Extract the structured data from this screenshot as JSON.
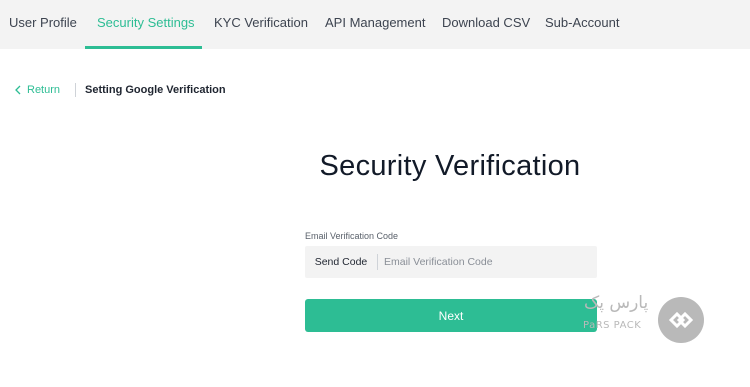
{
  "tabs": [
    {
      "label": "User Profile",
      "active": false
    },
    {
      "label": "Security Settings",
      "active": true
    },
    {
      "label": "KYC Verification",
      "active": false
    },
    {
      "label": "API Management",
      "active": false
    },
    {
      "label": "Download CSV",
      "active": false
    },
    {
      "label": "Sub-Account",
      "active": false
    }
  ],
  "breadcrumb": {
    "back_icon": "chevron-left-icon",
    "return_label": "Return",
    "current": "Setting Google Verification"
  },
  "main": {
    "title": "Security Verification",
    "email_field": {
      "label": "Email Verification Code",
      "send_code_label": "Send Code",
      "placeholder": "Email Verification Code",
      "value": ""
    },
    "next_label": "Next"
  },
  "watermark": {
    "text_fa": "پارس پک",
    "text_en": "PaRS PACK",
    "icon": "parspack-logo-icon"
  },
  "colors": {
    "accent": "#2dbd94",
    "nav_background": "#f3f3f3",
    "title": "#121a28"
  }
}
